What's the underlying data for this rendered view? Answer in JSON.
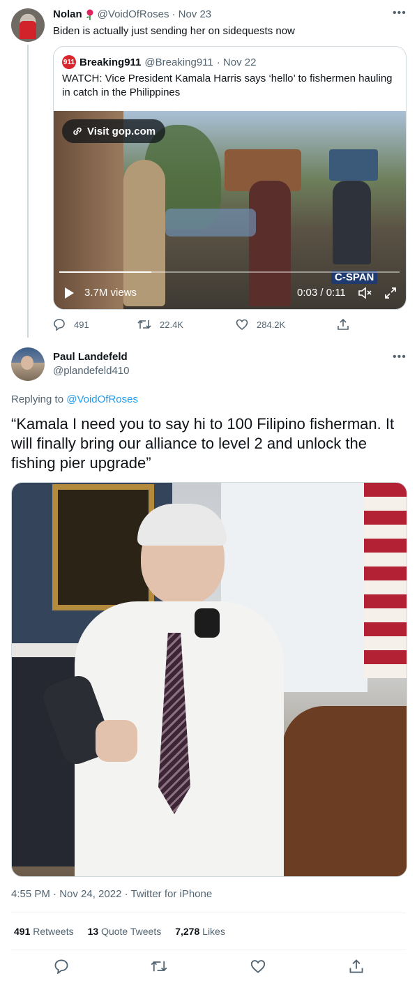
{
  "top_tweet": {
    "name": "Nolan",
    "handle": "@VoidOfRoses",
    "date": "· Nov 23",
    "text": "Biden is actually just sending her on sidequests now",
    "quoted": {
      "name": "Breaking911",
      "handle": "@Breaking911",
      "date": "· Nov 22",
      "text": "WATCH: Vice President Kamala Harris says ‘hello’ to fishermen hauling in catch in the Philippines",
      "visit_label": "Visit gop.com",
      "views": "3.7M views",
      "time": "0:03 / 0:11",
      "watermark": "C-SPAN",
      "progress": 0.27
    },
    "actions": {
      "replies": "491",
      "retweets": "22.4K",
      "likes": "284.2K"
    }
  },
  "main_tweet": {
    "name": "Paul Landefeld",
    "handle": "@plandefeld410",
    "replying_prefix": "Replying to",
    "replying_to": "@VoidOfRoses",
    "text": "“Kamala I need you to say hi to 100 Filipino fisherman. It will finally bring our alliance to level 2 and unlock the fishing pier upgrade”",
    "timestamp": "4:55 PM · Nov 24, 2022 · Twitter for iPhone",
    "stats": {
      "retweets_count": "491",
      "retweets_label": "Retweets",
      "quotes_count": "13",
      "quotes_label": "Quote Tweets",
      "likes_count": "7,278",
      "likes_label": "Likes"
    }
  },
  "colors": {
    "accent": "#1d9bf0",
    "text": "#0f1419",
    "muted": "#536471",
    "divider": "#eff3f4"
  },
  "icons": [
    "more-icon",
    "reply-icon",
    "retweet-icon",
    "like-icon",
    "share-icon",
    "play-icon",
    "mute-icon",
    "fullscreen-icon",
    "link-icon",
    "rose-icon"
  ]
}
